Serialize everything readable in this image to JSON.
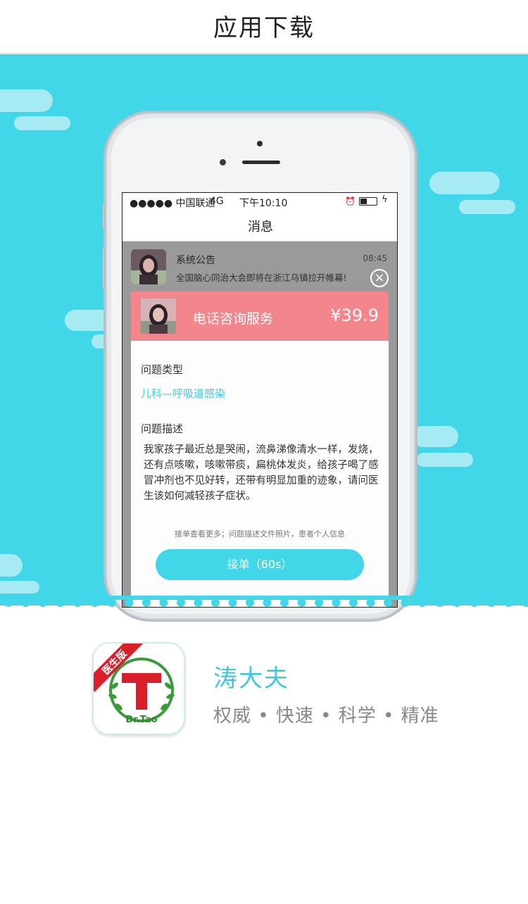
{
  "page": {
    "title": "应用下载"
  },
  "phone_screen": {
    "status_bar": {
      "signal": "●●●●● 中国联通",
      "network": "4G",
      "time": "下午10:10"
    },
    "nav_title": "消息",
    "message": {
      "title": "系统公告",
      "time": "08:45",
      "text": "全国脑心同治大会即将在浙江乌镇拉开帷幕!"
    },
    "order_card": {
      "service": "电话咨询服务",
      "price": "¥39.9",
      "type_label": "问题类型",
      "type_value": "儿科—呼吸道感染",
      "desc_label": "问题描述",
      "description": "我家孩子最近总是哭闹，流鼻涕像清水一样，发烧，还有点咳嗽，咳嗽带痰，扁桃体发炎，给孩子喝了感冒冲剂也不见好转，还带有明显加重的迹象，请问医生该如何减轻孩子症状。",
      "note": "接单查看更多；问题描述文件照片，患者个人信息",
      "accept_button": "接单（60s）"
    }
  },
  "app": {
    "name": "涛大夫",
    "slogan": "权威 • 快速 • 科学 • 精准",
    "icon_badge": "医生版",
    "icon_letter": "T",
    "icon_brand": "Dr.Tao"
  },
  "colors": {
    "cyan": "#41d7e9",
    "pink": "#f3858d",
    "red": "#d9202a",
    "green": "#3a9a3a"
  }
}
